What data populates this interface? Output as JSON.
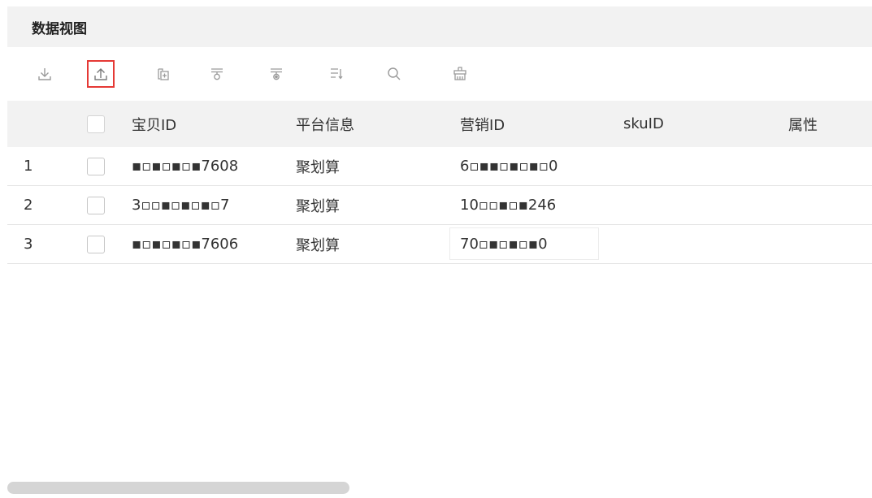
{
  "panel": {
    "title": "数据视图"
  },
  "toolbar": {
    "tools": [
      {
        "name": "download-icon",
        "icon": "download"
      },
      {
        "name": "upload-icon",
        "icon": "upload",
        "highlighted": true
      },
      {
        "name": "copy-icon",
        "icon": "copy"
      },
      {
        "name": "filter-icon",
        "icon": "filter"
      },
      {
        "name": "filter-clear-icon",
        "icon": "filter"
      },
      {
        "name": "sort-icon",
        "icon": "sort"
      },
      {
        "name": "search-icon",
        "icon": "search"
      },
      {
        "name": "clear-icon",
        "icon": "broom"
      }
    ],
    "highlight_color": "#e53935",
    "icon_color": "#9a9a9a"
  },
  "table": {
    "columns": [
      "宝贝ID",
      "平台信息",
      "营销ID",
      "skuID",
      "属性"
    ],
    "rows": [
      {
        "index": "1",
        "item_id": "▪▫▪▫▪▫▪7608",
        "platform": "聚划算",
        "marketing_id": "6▫▪▪▫▪▫▪▫0",
        "sku_id": "",
        "attr": ""
      },
      {
        "index": "2",
        "item_id": "3▫▫▪▫▪▫▪▫7",
        "platform": "聚划算",
        "marketing_id": "10▫▫▪▫▪246",
        "sku_id": "",
        "attr": ""
      },
      {
        "index": "3",
        "item_id": "▪▫▪▫▪▫▪7606",
        "platform": "聚划算",
        "marketing_id": "70▫▪▫▪▫▪0",
        "sku_id": "",
        "attr": ""
      }
    ]
  }
}
